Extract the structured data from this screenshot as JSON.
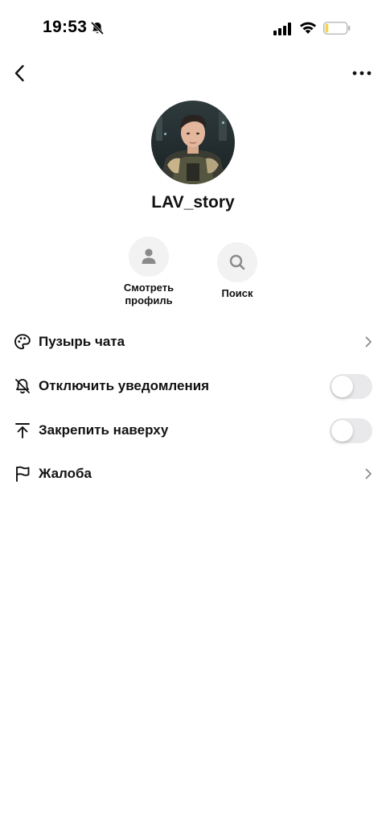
{
  "status_bar": {
    "time": "19:53",
    "icons": [
      "bell-slash-icon",
      "signal-icon",
      "wifi-icon",
      "battery-icon"
    ],
    "battery_level": 0.15,
    "battery_color": "#f5d547"
  },
  "header": {
    "back_icon": "chevron-left-icon",
    "more_icon": "ellipsis-icon"
  },
  "profile": {
    "username": "LAV_story"
  },
  "actions": {
    "view_profile_label": "Смотреть профиль",
    "search_label": "Поиск"
  },
  "settings": {
    "chat_bubble_label": "Пузырь чата",
    "mute_label": "Отключить уведомления",
    "mute_enabled": false,
    "pin_label": "Закрепить наверху",
    "pin_enabled": false,
    "report_label": "Жалоба"
  },
  "colors": {
    "toggle_off": "#e9e9eb",
    "action_bg": "#f2f2f2",
    "icon_gray": "#8a8a8a"
  }
}
